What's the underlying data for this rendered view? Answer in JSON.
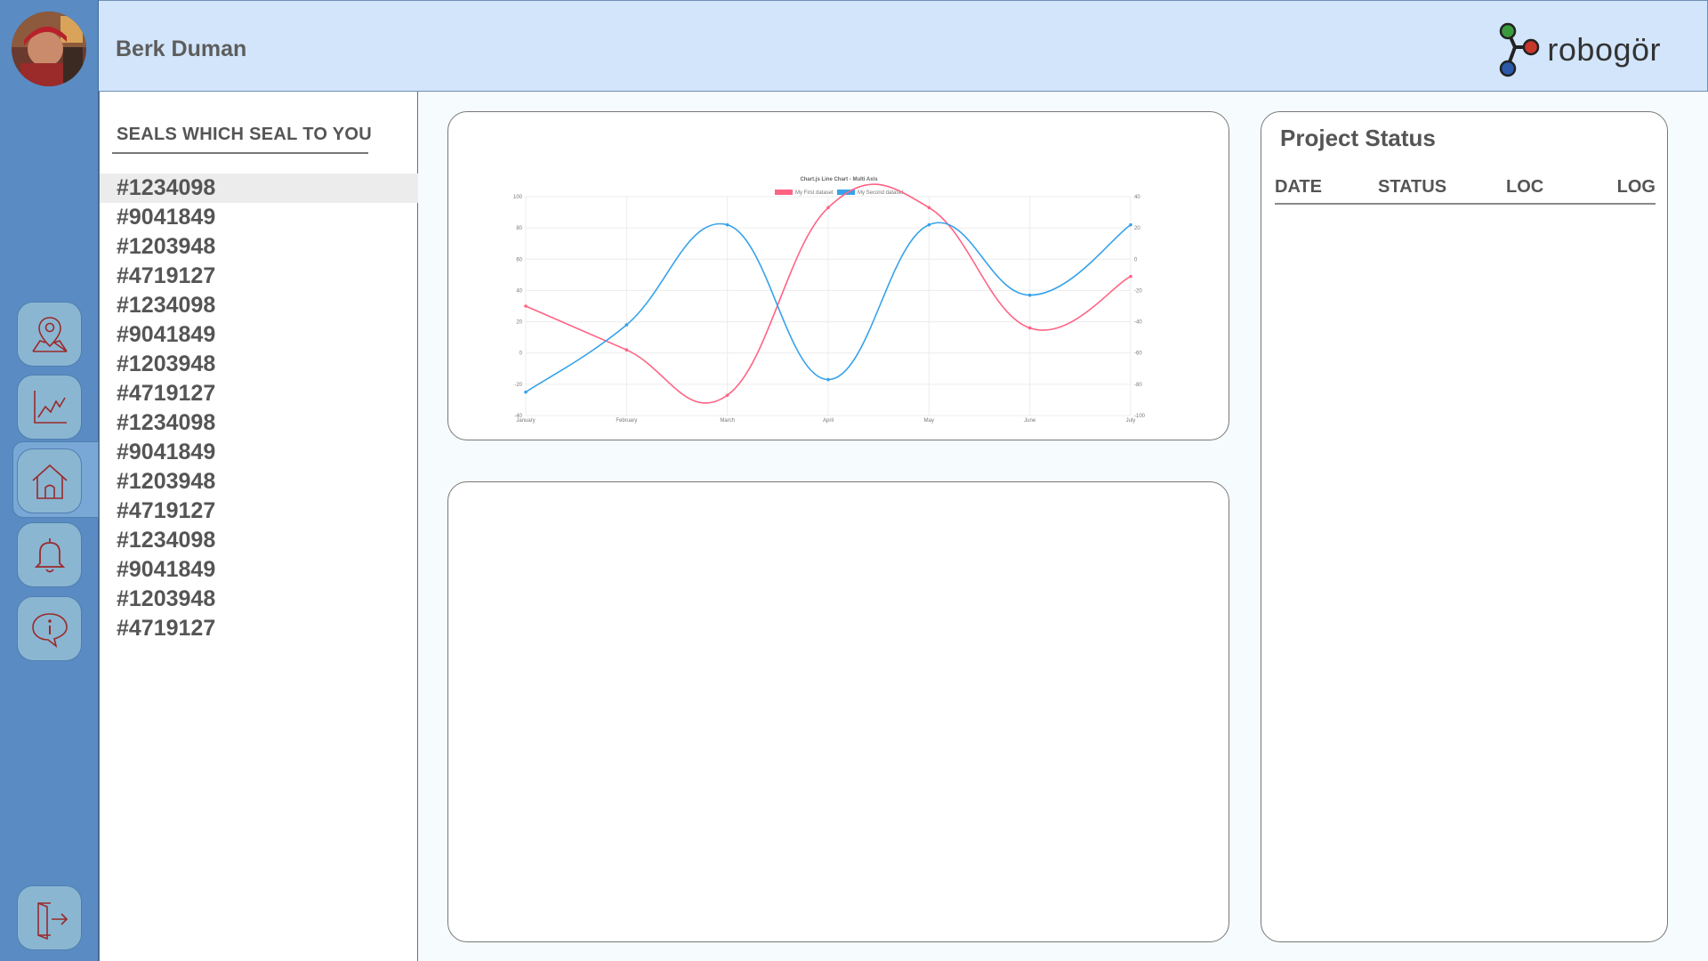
{
  "user": {
    "name": "Berk Duman"
  },
  "brand": {
    "name": "robogör",
    "colors": {
      "green": "#3a9a3e",
      "red": "#c8372b",
      "blue": "#2a5aa8"
    }
  },
  "nav": [
    {
      "name": "location-map-icon"
    },
    {
      "name": "line-chart-icon"
    },
    {
      "name": "home-icon",
      "active": true
    },
    {
      "name": "bell-icon"
    },
    {
      "name": "info-chat-icon"
    },
    {
      "name": "logout-icon"
    }
  ],
  "seals": {
    "title": "SEALS WHICH SEAL TO YOU",
    "items": [
      "#1234098",
      "#9041849",
      "#1203948",
      "#4719127",
      "#1234098",
      "#9041849",
      "#1203948",
      "#4719127",
      "#1234098",
      "#9041849",
      "#1203948",
      "#4719127",
      "#1234098",
      "#9041849",
      "#1203948",
      "#4719127"
    ],
    "selected_index": 0
  },
  "project_status": {
    "title": "Project Status",
    "columns": [
      "DATE",
      "STATUS",
      "LOC",
      "LOG"
    ],
    "rows": []
  },
  "chart_data": {
    "type": "line",
    "title": "Chart.js Line Chart - Multi Axis",
    "categories": [
      "January",
      "February",
      "March",
      "April",
      "May",
      "June",
      "July"
    ],
    "series": [
      {
        "name": "My First dataset",
        "axis": "left",
        "color": "#ff6384",
        "values": [
          30,
          2,
          -27,
          93,
          93,
          16,
          49
        ]
      },
      {
        "name": "My Second dataset",
        "axis": "right",
        "color": "#36a2eb",
        "values": [
          -85,
          -42,
          22,
          -77,
          22,
          -23,
          22
        ]
      }
    ],
    "y_left": {
      "min": -40,
      "max": 100,
      "ticks": [
        "100",
        "80",
        "60",
        "40",
        "20",
        "0",
        "-20",
        "-40"
      ]
    },
    "y_right": {
      "min": -100,
      "max": 40,
      "ticks": [
        "40",
        "20",
        "0",
        "-20",
        "-40",
        "-60",
        "-80",
        "-100"
      ]
    },
    "grid": true,
    "legend": "top"
  }
}
